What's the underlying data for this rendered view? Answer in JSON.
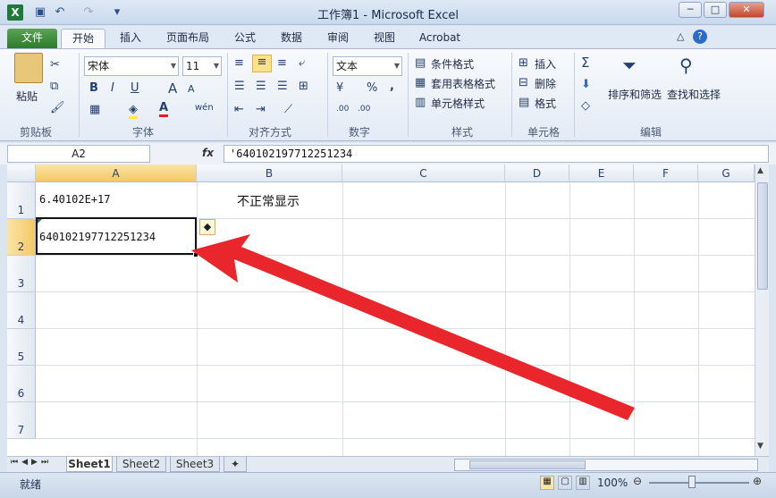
{
  "window": {
    "title": "工作簿1 - Microsoft Excel"
  },
  "quick_access": {
    "undo_icon": "↶",
    "redo_icon": "↷"
  },
  "ribbon_tabs": [
    "文件",
    "开始",
    "插入",
    "页面布局",
    "公式",
    "数据",
    "审阅",
    "视图",
    "Acrobat"
  ],
  "clipboard": {
    "paste_label": "粘贴",
    "group_label": "剪贴板"
  },
  "font": {
    "name": "宋体",
    "size": "11",
    "group_label": "字体",
    "bold": "B",
    "italic": "I",
    "underline": "U",
    "grow": "A",
    "shrink": "A",
    "wen": "wén"
  },
  "alignment": {
    "group_label": "对齐方式"
  },
  "number": {
    "format": "文本",
    "percent": "%",
    "comma": ",",
    "inc_decimal": ".00",
    "dec_decimal": ".00",
    "group_label": "数字"
  },
  "styles": {
    "conditional": "条件格式",
    "table": "套用表格格式",
    "cell": "单元格样式",
    "group_label": "样式"
  },
  "cells": {
    "insert": "插入",
    "delete": "删除",
    "format": "格式",
    "group_label": "单元格"
  },
  "editing": {
    "sigma": "Σ",
    "sort": "排序和筛选",
    "find": "查找和选择",
    "group_label": "编辑"
  },
  "formula_bar": {
    "name_box": "A2",
    "fx": "fx",
    "content": "'640102197712251234"
  },
  "columns": [
    "A",
    "B",
    "C",
    "D",
    "E",
    "F",
    "G"
  ],
  "rows": [
    "1",
    "2",
    "3",
    "4",
    "5",
    "6",
    "7"
  ],
  "cells_data": {
    "a1": "6.40102E+17",
    "b1": "不正常显示",
    "a2": "640102197712251234"
  },
  "sheets": [
    "Sheet1",
    "Sheet2",
    "Sheet3"
  ],
  "status": {
    "ready": "就绪",
    "zoom": "100%"
  },
  "colors": {
    "accent": "#2e7a2c",
    "arrow": "#e8262b"
  }
}
